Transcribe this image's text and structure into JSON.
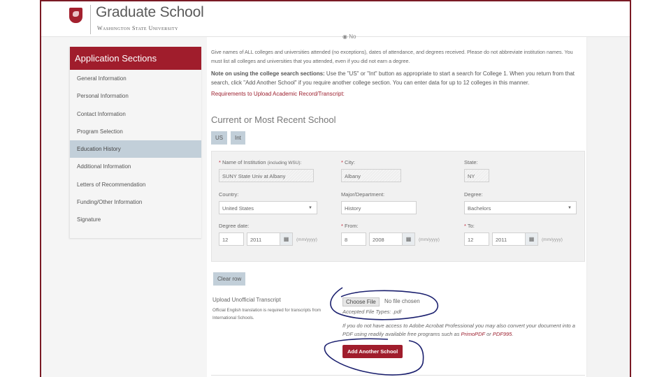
{
  "header": {
    "title": "Graduate School",
    "subtitle": "Washington State University",
    "logo_icon": "wsu-cougar-shield-icon"
  },
  "sidebar": {
    "title": "Application Sections",
    "items": [
      {
        "label": "General Information",
        "active": false
      },
      {
        "label": "Personal Information",
        "active": false
      },
      {
        "label": "Contact Information",
        "active": false
      },
      {
        "label": "Program Selection",
        "active": false
      },
      {
        "label": "Education History",
        "active": true
      },
      {
        "label": "Additional Information",
        "active": false
      },
      {
        "label": "Letters of Recommendation",
        "active": false
      },
      {
        "label": "Funding/Other Information",
        "active": false
      },
      {
        "label": "Signature",
        "active": false
      }
    ]
  },
  "main": {
    "radio_no_label": "No",
    "intro_text": "Give names of ALL colleges and universities attended (no exceptions), dates of attendance, and degrees received. Please do not abbreviate institution names. You must list all colleges and universities that you attended, even if you did not earn a degree.",
    "note_bold": "Note on using the college search sections:",
    "note_text": " Use the \"US\" or \"Int\" button as appropriate to start a search for College 1. When you return from that search, click \"Add Another School\" if you require another college section. You can enter data for up to 12 colleges in this manner.",
    "requirements_link": "Requirements to Upload Academic Record/Transcript:",
    "section_title": "Current or Most Recent School",
    "search_buttons": {
      "us": "US",
      "int": "Int"
    },
    "form": {
      "institution_label": "Name of Institution",
      "institution_label_note": "(including WSU):",
      "institution_value": "SUNY State Univ at Albany",
      "city_label": "City:",
      "city_value": "Albany",
      "state_label": "State:",
      "state_value": "NY",
      "country_label": "Country:",
      "country_value": "United States",
      "major_label": "Major/Department:",
      "major_value": "History",
      "degree_label": "Degree:",
      "degree_value": "Bachelors",
      "degree_date_label": "Degree date:",
      "degree_date_month": "12",
      "degree_date_year": "2011",
      "from_label": "From:",
      "from_month": "8",
      "from_year": "2008",
      "to_label": "To:",
      "to_month": "12",
      "to_year": "2011",
      "date_format": "(mm/yyyy)",
      "required_marker": "*"
    },
    "clear_row_label": "Clear row",
    "upload": {
      "label": "Upload Unofficial Transcript",
      "note": "Official English translation is required for transcripts from International Schools.",
      "choose_file_label": "Choose File",
      "file_status": "No file chosen",
      "accepted_types": "Accepted File Types: .pdf",
      "convert_text": "If you do not have access to Adobe Acrobat Professional you may also convert your document into a PDF using readily available free programs such as ",
      "convert_link1": "PrimoPDF",
      "convert_or": " or ",
      "convert_link2": "PDF995",
      "convert_end": "."
    },
    "add_school_label": "Add Another School"
  },
  "colors": {
    "brand_crimson": "#a01d2c",
    "frame_border": "#7a1a24",
    "button_gray_blue": "#c2cfd9",
    "annotation_ink": "#1a1f6e"
  }
}
